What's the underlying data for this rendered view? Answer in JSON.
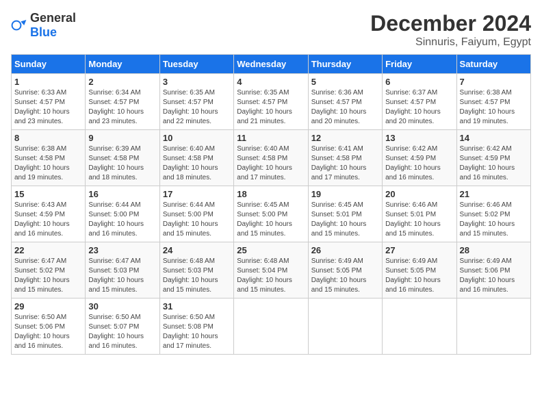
{
  "logo": {
    "general": "General",
    "blue": "Blue"
  },
  "title": "December 2024",
  "location": "Sinnuris, Faiyum, Egypt",
  "weekdays": [
    "Sunday",
    "Monday",
    "Tuesday",
    "Wednesday",
    "Thursday",
    "Friday",
    "Saturday"
  ],
  "weeks": [
    [
      {
        "day": "1",
        "sunrise": "6:33 AM",
        "sunset": "4:57 PM",
        "daylight": "10 hours and 23 minutes."
      },
      {
        "day": "2",
        "sunrise": "6:34 AM",
        "sunset": "4:57 PM",
        "daylight": "10 hours and 23 minutes."
      },
      {
        "day": "3",
        "sunrise": "6:35 AM",
        "sunset": "4:57 PM",
        "daylight": "10 hours and 22 minutes."
      },
      {
        "day": "4",
        "sunrise": "6:35 AM",
        "sunset": "4:57 PM",
        "daylight": "10 hours and 21 minutes."
      },
      {
        "day": "5",
        "sunrise": "6:36 AM",
        "sunset": "4:57 PM",
        "daylight": "10 hours and 20 minutes."
      },
      {
        "day": "6",
        "sunrise": "6:37 AM",
        "sunset": "4:57 PM",
        "daylight": "10 hours and 20 minutes."
      },
      {
        "day": "7",
        "sunrise": "6:38 AM",
        "sunset": "4:57 PM",
        "daylight": "10 hours and 19 minutes."
      }
    ],
    [
      {
        "day": "8",
        "sunrise": "6:38 AM",
        "sunset": "4:58 PM",
        "daylight": "10 hours and 19 minutes."
      },
      {
        "day": "9",
        "sunrise": "6:39 AM",
        "sunset": "4:58 PM",
        "daylight": "10 hours and 18 minutes."
      },
      {
        "day": "10",
        "sunrise": "6:40 AM",
        "sunset": "4:58 PM",
        "daylight": "10 hours and 18 minutes."
      },
      {
        "day": "11",
        "sunrise": "6:40 AM",
        "sunset": "4:58 PM",
        "daylight": "10 hours and 17 minutes."
      },
      {
        "day": "12",
        "sunrise": "6:41 AM",
        "sunset": "4:58 PM",
        "daylight": "10 hours and 17 minutes."
      },
      {
        "day": "13",
        "sunrise": "6:42 AM",
        "sunset": "4:59 PM",
        "daylight": "10 hours and 16 minutes."
      },
      {
        "day": "14",
        "sunrise": "6:42 AM",
        "sunset": "4:59 PM",
        "daylight": "10 hours and 16 minutes."
      }
    ],
    [
      {
        "day": "15",
        "sunrise": "6:43 AM",
        "sunset": "4:59 PM",
        "daylight": "10 hours and 16 minutes."
      },
      {
        "day": "16",
        "sunrise": "6:44 AM",
        "sunset": "5:00 PM",
        "daylight": "10 hours and 16 minutes."
      },
      {
        "day": "17",
        "sunrise": "6:44 AM",
        "sunset": "5:00 PM",
        "daylight": "10 hours and 15 minutes."
      },
      {
        "day": "18",
        "sunrise": "6:45 AM",
        "sunset": "5:00 PM",
        "daylight": "10 hours and 15 minutes."
      },
      {
        "day": "19",
        "sunrise": "6:45 AM",
        "sunset": "5:01 PM",
        "daylight": "10 hours and 15 minutes."
      },
      {
        "day": "20",
        "sunrise": "6:46 AM",
        "sunset": "5:01 PM",
        "daylight": "10 hours and 15 minutes."
      },
      {
        "day": "21",
        "sunrise": "6:46 AM",
        "sunset": "5:02 PM",
        "daylight": "10 hours and 15 minutes."
      }
    ],
    [
      {
        "day": "22",
        "sunrise": "6:47 AM",
        "sunset": "5:02 PM",
        "daylight": "10 hours and 15 minutes."
      },
      {
        "day": "23",
        "sunrise": "6:47 AM",
        "sunset": "5:03 PM",
        "daylight": "10 hours and 15 minutes."
      },
      {
        "day": "24",
        "sunrise": "6:48 AM",
        "sunset": "5:03 PM",
        "daylight": "10 hours and 15 minutes."
      },
      {
        "day": "25",
        "sunrise": "6:48 AM",
        "sunset": "5:04 PM",
        "daylight": "10 hours and 15 minutes."
      },
      {
        "day": "26",
        "sunrise": "6:49 AM",
        "sunset": "5:05 PM",
        "daylight": "10 hours and 15 minutes."
      },
      {
        "day": "27",
        "sunrise": "6:49 AM",
        "sunset": "5:05 PM",
        "daylight": "10 hours and 16 minutes."
      },
      {
        "day": "28",
        "sunrise": "6:49 AM",
        "sunset": "5:06 PM",
        "daylight": "10 hours and 16 minutes."
      }
    ],
    [
      {
        "day": "29",
        "sunrise": "6:50 AM",
        "sunset": "5:06 PM",
        "daylight": "10 hours and 16 minutes."
      },
      {
        "day": "30",
        "sunrise": "6:50 AM",
        "sunset": "5:07 PM",
        "daylight": "10 hours and 16 minutes."
      },
      {
        "day": "31",
        "sunrise": "6:50 AM",
        "sunset": "5:08 PM",
        "daylight": "10 hours and 17 minutes."
      },
      null,
      null,
      null,
      null
    ]
  ]
}
